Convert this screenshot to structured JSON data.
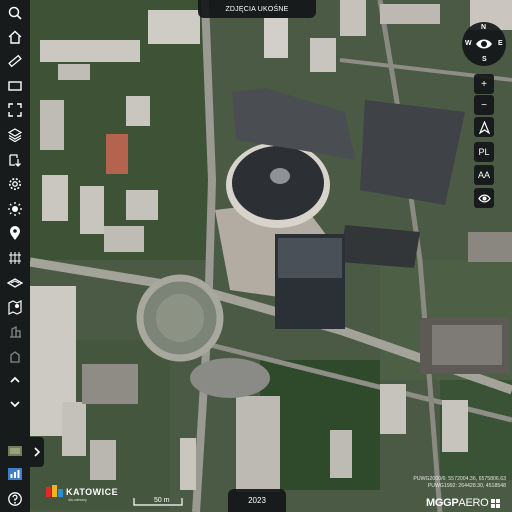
{
  "top_label": "ZDJĘCIA UKOŚNE",
  "year": "2023",
  "scale_label": "50 m",
  "coordinates": {
    "line1": "PUWG2000/6: 5572004.36, 6575806.63",
    "line2": "PUWG1992: 264428.30, 4518548"
  },
  "logo_left": {
    "name": "KATOWICE",
    "sub": "dla odmiany"
  },
  "logo_right": {
    "bold": "MGGP",
    "rest": "AERO"
  },
  "compass": {
    "north": "N",
    "south": "S",
    "west": "W",
    "east": "E"
  },
  "right_controls": {
    "zoom_in": "+",
    "zoom_out": "−",
    "projection_label": "PL",
    "text_size_label": "AA"
  },
  "left_toolbar": [
    "search-icon",
    "home-icon",
    "ruler-icon",
    "rectangle-icon",
    "fullscreen-icon",
    "layers-icon",
    "download-icon",
    "settings-icon",
    "brightness-icon",
    "location-pin-icon",
    "grid-icon",
    "3d-icon",
    "map-pin-icon",
    "building-icon",
    "chevron-up-icon",
    "chevron-down-icon",
    "photo-icon",
    "chart-icon",
    "help-icon"
  ],
  "colors": {
    "panel": "#141618",
    "text": "#ffffff",
    "accent_red": "#e0282d"
  }
}
